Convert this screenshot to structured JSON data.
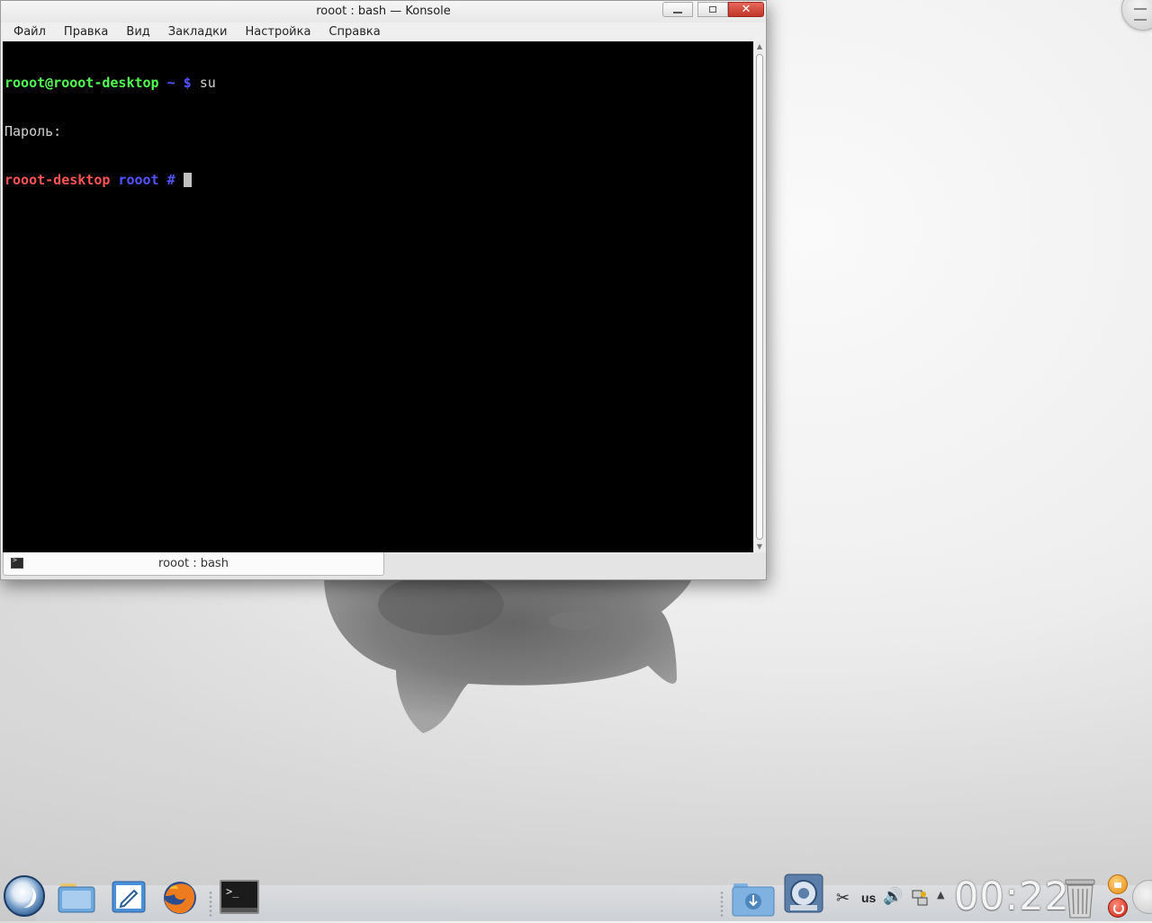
{
  "window": {
    "title": "rooot : bash — Konsole",
    "controls": [
      "minimize",
      "maximize",
      "close"
    ]
  },
  "menubar": {
    "items": [
      "Файл",
      "Правка",
      "Вид",
      "Закладки",
      "Настройка",
      "Справка"
    ]
  },
  "terminal": {
    "line1": {
      "user_host": "rooot@rooot-desktop",
      "path_sep": " ~ $",
      "command": " su"
    },
    "line2": {
      "text": "Пароль:"
    },
    "line3": {
      "host": "rooot-desktop",
      "dir": " rooot",
      "prompt": " # "
    },
    "colors": {
      "background": "#000000",
      "green": "#54ff54",
      "blue": "#5454ff",
      "red": "#ff5454",
      "text": "#d0d0d0"
    }
  },
  "tabs": [
    {
      "label": "rooot : bash",
      "icon": "terminal-icon",
      "active": true
    }
  ],
  "panel": {
    "launchers": [
      {
        "name": "application-launcher",
        "icon": "kde-logo-icon"
      },
      {
        "name": "dolphin",
        "icon": "folder-icon"
      },
      {
        "name": "kwrite",
        "icon": "text-editor-icon"
      },
      {
        "name": "firefox",
        "icon": "firefox-icon"
      }
    ],
    "tasks": [
      {
        "name": "konsole",
        "icon": "terminal-icon",
        "active": true
      }
    ],
    "tray": {
      "keyboard_layout": "us",
      "icons": [
        "device-notifier-icon",
        "system-info-icon",
        "clipboard-icon",
        "volume-icon",
        "network-icon",
        "expand-arrow-icon"
      ]
    },
    "clock": "00:22",
    "accent": "#e88a12",
    "logout_color": "#c82414"
  }
}
